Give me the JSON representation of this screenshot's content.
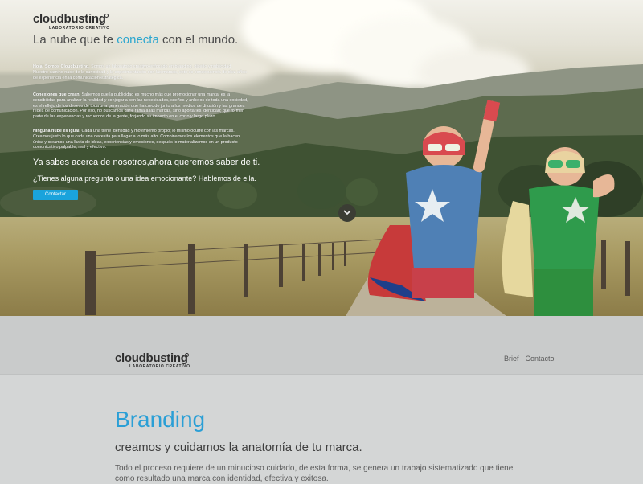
{
  "brand": {
    "name": "cloudbusting",
    "subtitle": "LABORATORIO CREATIVO"
  },
  "hero": {
    "tagline_pre": "La nube que te ",
    "tagline_highlight": "conecta",
    "tagline_post": " con el mundo.",
    "paragraphs": [
      {
        "lead": "Hola! Somos Cloudbusting.",
        "text": " Somos un laboratorio creativo enfocado en branding, diseño y publicidad. Nuestro camino nace de la curiosidad y la experimentación con las marcas, esto es consecuencia de diez años de experiencia en la comunicación estratégica."
      },
      {
        "lead": "Conexiones que crean.",
        "text": " Sabemos que la publicidad es mucho más que promocionar una marca, es la sensibilidad para analizar la realidad y conjugarla con las necesidades, sueños y anhelos de toda una sociedad, es el reflejo de los deseos de toda una generación que ha crecido junto a los medios de difusión y las grandes redes de comunicación. Por eso, no buscamos darle fama a las marcas, sino aportarles identidad; que formen parte de las experiencias y recuerdos de la gente, forjando su impacto en el corto y largo plazo."
      },
      {
        "lead": "Ninguna nube es igual.",
        "text": " Cada una tiene identidad y movimiento propio; lo mismo ocurre con las marcas. Creamos justo lo que cada una necesita para llegar a lo más alto. Combinamos los elementos que la hacen única y creamos una lluvia de ideas, experiencias y emociones, después lo materializamos en un producto comunicativo palpable, real y efectivo."
      }
    ],
    "cta_line1": "Ya sabes acerca de nosotros,ahora queremos saber de ti.",
    "cta_line2": "¿Tienes alguna pregunta o una idea emocionante? Hablemos de ella.",
    "contact_button": "Contactar",
    "scroll_icon": "chevron-down-icon"
  },
  "nav": {
    "links": [
      "Brief",
      "Contacto"
    ]
  },
  "branding": {
    "title": "Branding",
    "subtitle": "creamos y cuidamos la anatomía de tu marca.",
    "body": "Todo el proceso requiere de un minucioso cuidado, de esta forma, se genera un trabajo sistematizado que tiene como resultado una marca con identidad, efectiva y exitosa."
  },
  "colors": {
    "accent": "#2aa6cf",
    "button": "#1aa3dc",
    "nav_bg": "#c9cbcb",
    "section_bg": "#d4d6d6"
  }
}
